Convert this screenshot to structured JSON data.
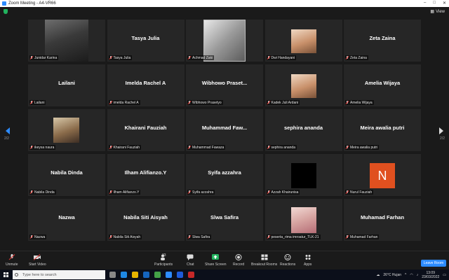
{
  "window": {
    "title": "Zoom Meeting - A4-VR66"
  },
  "header": {
    "view_label": "View"
  },
  "pagination": {
    "left": "2/2",
    "right": "2/2"
  },
  "participants": [
    {
      "big": "",
      "label": "Junidar Karina",
      "photo": "man-cap"
    },
    {
      "big": "Tasya Julia",
      "label": "Tasya Julia"
    },
    {
      "big": "",
      "label": "Achmad Zaki",
      "photo": "logo-az"
    },
    {
      "big": "",
      "label": "Dwi Handayani",
      "photo": "face-small"
    },
    {
      "big": "Zeta Zaina",
      "label": "Zeta Zaina"
    },
    {
      "big": "Lailani",
      "label": "Lailani"
    },
    {
      "big": "Imelda Rachel A",
      "label": "imelda Rachel A"
    },
    {
      "big": "Wibhowo Praset...",
      "label": "Wibhowo Prasetyo"
    },
    {
      "big": "",
      "label": "Kadek Juli Ardani",
      "photo": "face-small"
    },
    {
      "big": "Amelia Wijaya",
      "label": "Amelia Wijaya"
    },
    {
      "big": "",
      "label": "ikeysa naura",
      "photo": "girl-room"
    },
    {
      "big": "Khairani Fauziah",
      "label": "Khairani Fauziah"
    },
    {
      "big": "Muhammad  Faw...",
      "label": "Muhammad Fawaza"
    },
    {
      "big": "sephira ananda",
      "label": "sephira ananda"
    },
    {
      "big": "Meira awalia putri",
      "label": "Meira awalia putri"
    },
    {
      "big": "Nabila Dinda",
      "label": "Nabila Dinda"
    },
    {
      "big": "Ilham Alifianzo.Y",
      "label": "Ilham Alifianzo.Y"
    },
    {
      "big": "Syifa azzahra",
      "label": "Syifa azzahra"
    },
    {
      "big": "",
      "label": "Azzah Khairunisa",
      "photo": "black"
    },
    {
      "big": "",
      "label": "Nurul Fauziah",
      "photo": "avatar-n",
      "avatar_letter": "N"
    },
    {
      "big": "Nazwa",
      "label": "Nazwa"
    },
    {
      "big": "Nabila Siti Aisyah",
      "label": "Nabila Siti Aisyah"
    },
    {
      "big": "Slwa Safira",
      "label": "Slwa Safira"
    },
    {
      "big": "",
      "label": "peserta_rima imroatur_TLK-21",
      "photo": "hijab"
    },
    {
      "big": "Muhamad Farhan",
      "label": "Muhamad Farhan"
    }
  ],
  "toolbar": {
    "unmute": "Unmute",
    "start_video": "Start Video",
    "participants": "Participants",
    "participants_count": "33",
    "chat": "Chat",
    "share_screen": "Share Screen",
    "record": "Record",
    "breakout": "Breakout Rooms",
    "reactions": "Reactions",
    "apps": "Apps",
    "leave": "Leave Room"
  },
  "taskbar": {
    "search_placeholder": "Type here to search",
    "weather": "26°C  Hujan",
    "time": "13:09",
    "date": "23/03/2022"
  },
  "colors": {
    "accent": "#2d8cff",
    "share_green": "#22b35e",
    "avatar_orange": "#e0501f"
  }
}
